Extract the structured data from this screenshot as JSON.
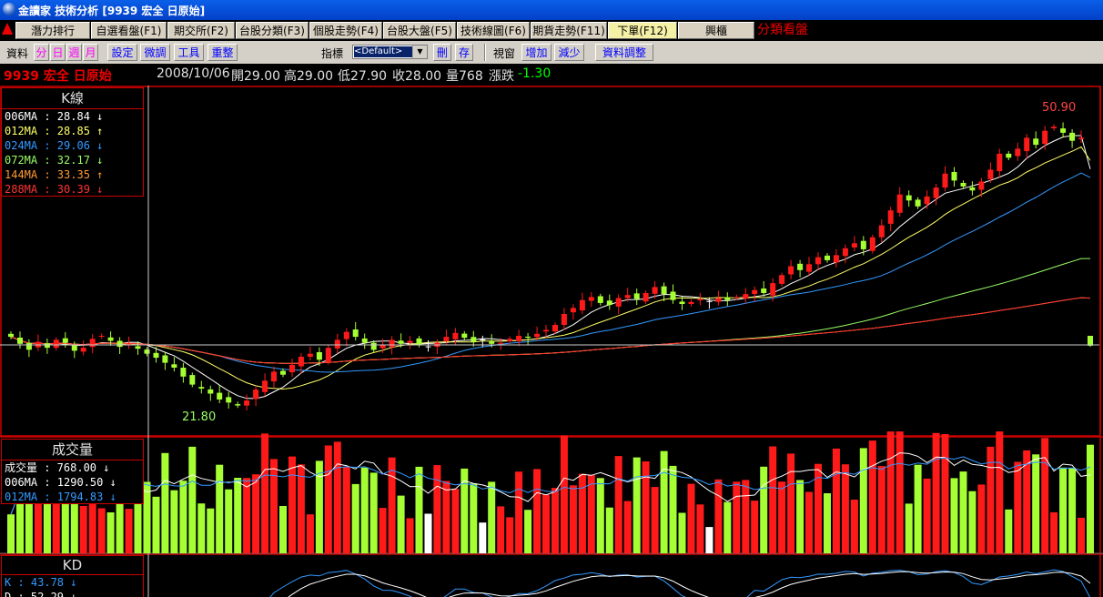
{
  "window": {
    "title": "金讀家 技術分析 [9939 宏全 日原始]"
  },
  "menu": {
    "items": [
      {
        "label": "潛力排行"
      },
      {
        "label": "自選看盤(F1)"
      },
      {
        "label": "期交所(F2)"
      },
      {
        "label": "台股分類(F3)"
      },
      {
        "label": "個股走勢(F4)"
      },
      {
        "label": "台股大盤(F5)"
      },
      {
        "label": "技術線圖(F6)"
      },
      {
        "label": "期貨走勢(F11)"
      },
      {
        "label": "下單(F12)"
      },
      {
        "label": "興櫃"
      }
    ],
    "right_label": "分類看盤"
  },
  "toolbar": {
    "data_label": "資料",
    "freq": [
      "分",
      "日",
      "週",
      "月"
    ],
    "buttons": [
      "設定",
      "微調",
      "工具",
      "重整"
    ],
    "indicator_label": "指標",
    "indicator_value": "<Default>",
    "ind_buttons": [
      "刪",
      "存"
    ],
    "window_label": "視窗",
    "win_buttons": [
      "增加",
      "減少"
    ],
    "adjust_button": "資料調整"
  },
  "info": {
    "symbol": "9939 宏全 日原始",
    "date": "2008/10/06",
    "open": "開29.00",
    "high": "高29.00",
    "low": "低27.90",
    "close": "收28.00",
    "volume": "量768",
    "change_label": "漲跌",
    "change": "-1.30"
  },
  "kline_panel": {
    "title": "K線",
    "ma": [
      {
        "text": "006MA : 28.84 ↓",
        "color": "#ffffff"
      },
      {
        "text": "012MA : 28.85 ↑",
        "color": "#ffff66"
      },
      {
        "text": "024MA : 29.06 ↓",
        "color": "#3399ff"
      },
      {
        "text": "072MA : 32.17 ↓",
        "color": "#99ff66"
      },
      {
        "text": "144MA : 33.35 ↑",
        "color": "#ff9933"
      },
      {
        "text": "288MA : 30.39 ↓",
        "color": "#ff3333"
      }
    ],
    "max_label": "50.90",
    "min_label": "21.80"
  },
  "volume_panel": {
    "title": "成交量",
    "rows": [
      {
        "text": "成交量 : 768.00 ↓",
        "color": "#ffffff"
      },
      {
        "text": "006MA : 1290.50 ↓",
        "color": "#ffffff"
      },
      {
        "text": "012MA : 1794.83 ↓",
        "color": "#3399ff"
      }
    ]
  },
  "kd_panel": {
    "title": "KD",
    "rows": [
      {
        "text": "K : 43.78 ↓",
        "color": "#3399ff"
      },
      {
        "text": "D : 52.29 ↓",
        "color": "#ffffff"
      }
    ]
  },
  "colors": {
    "up": "#ff1a1a",
    "down": "#a6ff33",
    "flat": "#ffffff",
    "frame": "#cc0000"
  },
  "chart_data": {
    "type": "candlestick",
    "close": [
      28.9,
      28.2,
      27.6,
      28.4,
      27.8,
      28.6,
      28.3,
      27.5,
      27.8,
      28.7,
      29.0,
      28.5,
      27.9,
      28.2,
      27.7,
      27.2,
      26.8,
      26.3,
      25.8,
      24.9,
      24.1,
      23.7,
      23.2,
      22.6,
      22.3,
      22.0,
      22.5,
      23.6,
      24.5,
      25.4,
      25.1,
      26.1,
      26.9,
      27.2,
      26.6,
      27.8,
      28.6,
      29.4,
      28.9,
      28.3,
      27.6,
      28.1,
      28.6,
      28.2,
      28.5,
      28.1,
      27.9,
      28.3,
      28.9,
      29.3,
      28.8,
      28.4,
      28.6,
      28.2,
      28.3,
      28.7,
      29.0,
      28.8,
      29.2,
      29.6,
      30.1,
      31.2,
      31.8,
      32.6,
      32.9,
      32.3,
      32.1,
      32.8,
      33.1,
      32.7,
      33.3,
      33.9,
      33.2,
      32.6,
      32.2,
      32.4,
      32.7,
      32.5,
      32.8,
      32.6,
      32.9,
      33.2,
      33.6,
      33.3,
      34.3,
      35.1,
      36.0,
      35.6,
      36.2,
      36.9,
      36.6,
      37.1,
      37.8,
      38.3,
      37.7,
      38.9,
      40.1,
      41.6,
      43.2,
      42.6,
      42.0,
      43.0,
      43.9,
      45.3,
      44.6,
      44.0,
      43.6,
      44.5,
      45.7,
      47.3,
      46.9,
      47.8,
      48.9,
      48.2,
      49.6,
      50.0,
      49.4,
      48.6,
      48.9,
      28.0
    ],
    "volume_scale": "relative"
  }
}
